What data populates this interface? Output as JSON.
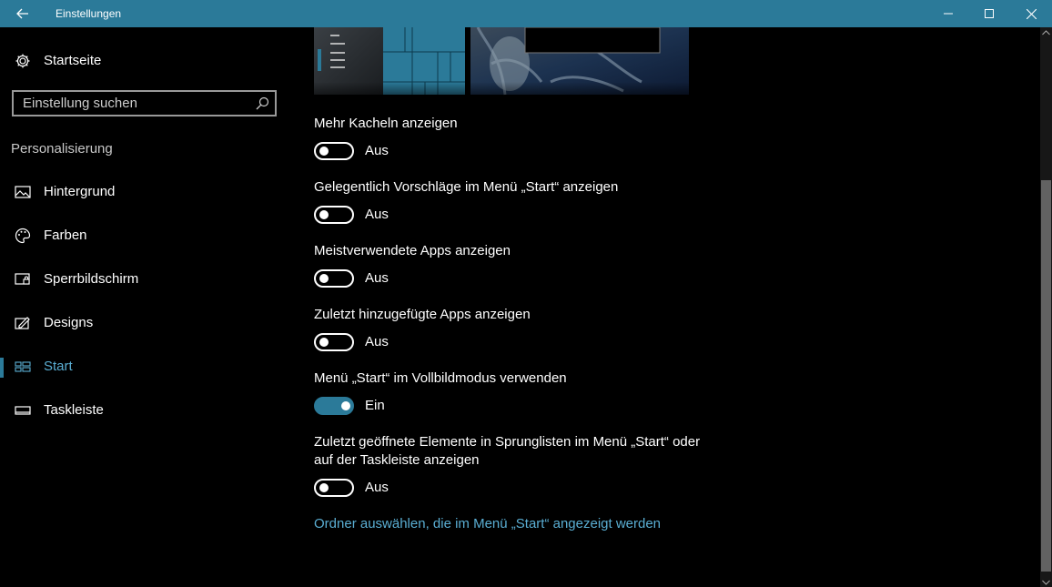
{
  "window": {
    "title": "Einstellungen"
  },
  "sidebar": {
    "home_label": "Startseite",
    "search_placeholder": "Einstellung suchen",
    "section_title": "Personalisierung",
    "items": [
      {
        "label": "Hintergrund",
        "icon": "picture-icon"
      },
      {
        "label": "Farben",
        "icon": "palette-icon"
      },
      {
        "label": "Sperrbildschirm",
        "icon": "lock-screen-icon"
      },
      {
        "label": "Designs",
        "icon": "designs-icon"
      },
      {
        "label": "Start",
        "icon": "start-tiles-icon",
        "active": true
      },
      {
        "label": "Taskleiste",
        "icon": "taskbar-icon"
      }
    ]
  },
  "settings": [
    {
      "label": "Mehr Kacheln anzeigen",
      "state": "Aus",
      "on": false
    },
    {
      "label": "Gelegentlich Vorschläge im Menü „Start“ anzeigen",
      "state": "Aus",
      "on": false
    },
    {
      "label": "Meistverwendete Apps anzeigen",
      "state": "Aus",
      "on": false
    },
    {
      "label": "Zuletzt hinzugefügte Apps anzeigen",
      "state": "Aus",
      "on": false
    },
    {
      "label": "Menü „Start“ im Vollbildmodus verwenden",
      "state": "Ein",
      "on": true
    },
    {
      "label_line1": "Zuletzt geöffnete Elemente in Sprunglisten im Menü „Start“ oder",
      "label_line2": "auf der Taskleiste anzeigen",
      "state": "Aus",
      "on": false
    }
  ],
  "folder_link": "Ordner auswählen, die im Menü „Start“ angezeigt werden",
  "colors": {
    "accent": "#2b7a99",
    "link": "#5aaed3",
    "background": "#000000"
  }
}
